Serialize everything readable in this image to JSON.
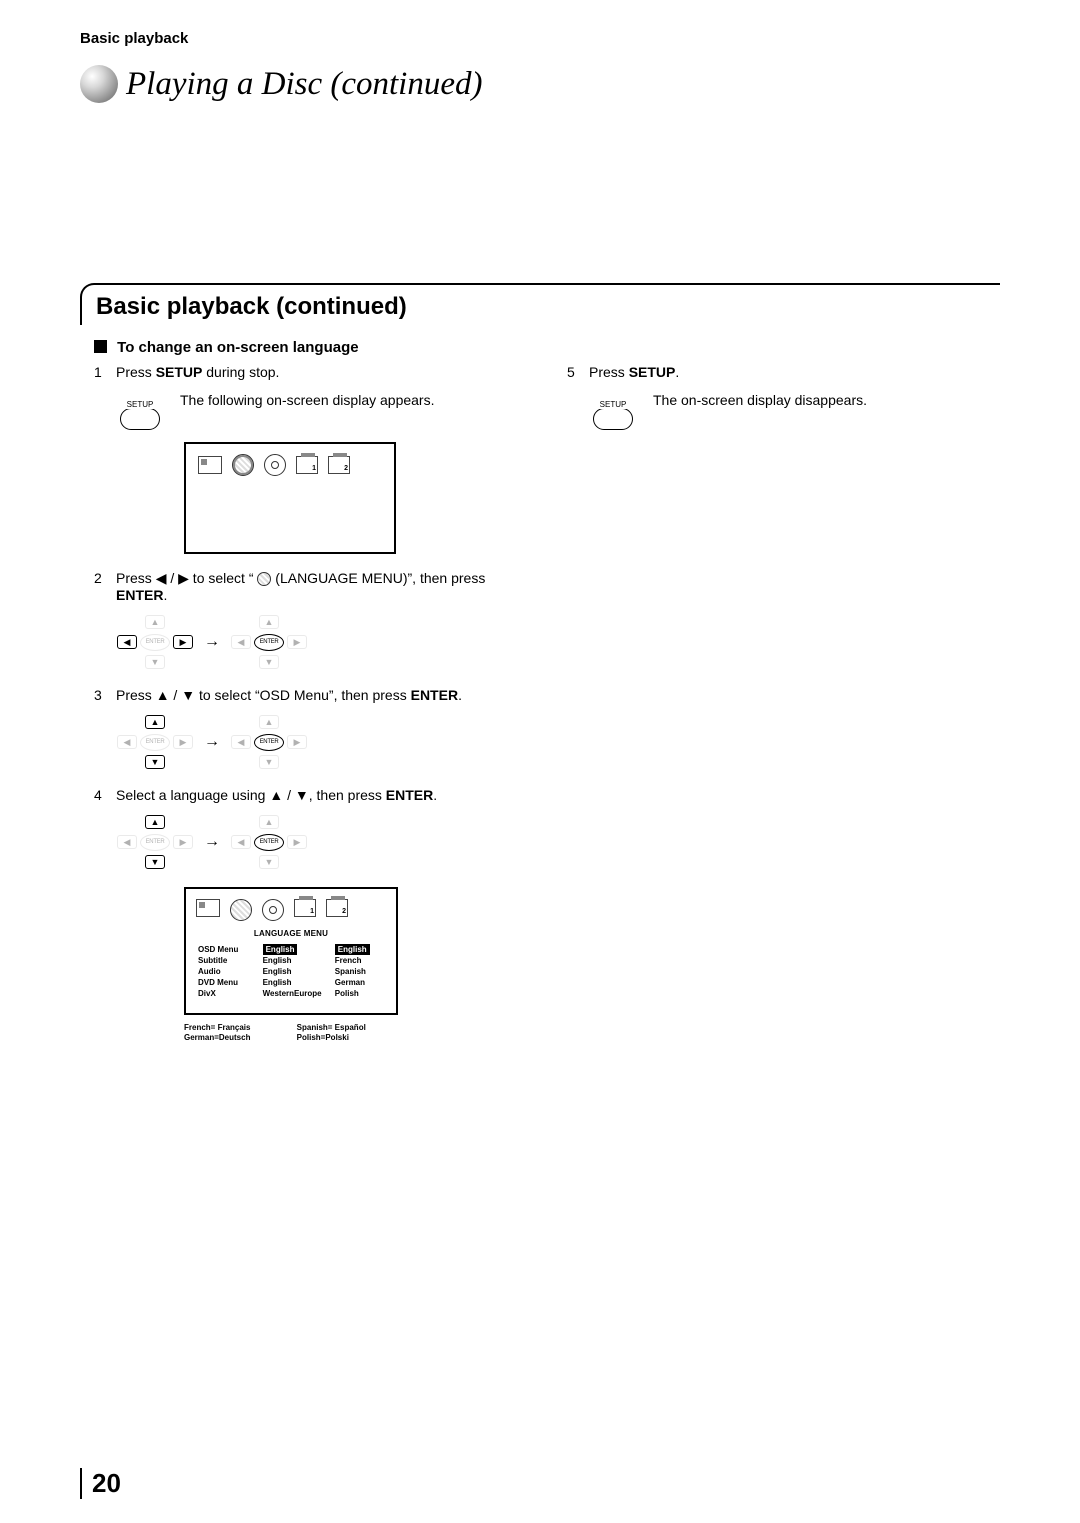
{
  "header": {
    "section": "Basic playback"
  },
  "title": "Playing a Disc (continued)",
  "sectionTitle": "Basic playback (continued)",
  "subHeading": "To change an on-screen language",
  "left": {
    "s1": {
      "num": "1",
      "a": "Press ",
      "b": "SETUP",
      "c": " during stop."
    },
    "s1_caption": "The following on-screen display appears.",
    "s2": {
      "num": "2",
      "pre": "Press ",
      "mid": " to select “ ",
      "post": " (LANGUAGE MENU)”, then press ",
      "enter": "ENTER",
      "end": "."
    },
    "s3": {
      "num": "3",
      "pre": "Press ",
      "mid": " to select “OSD Menu”, then press ",
      "enter": "ENTER",
      "end": "."
    },
    "s4": {
      "num": "4",
      "pre": "Select a language using ",
      "mid": ", then press ",
      "enter": "ENTER",
      "end": "."
    }
  },
  "right": {
    "s5": {
      "num": "5",
      "a": "Press ",
      "b": "SETUP",
      "c": "."
    },
    "s5_caption": "The on-screen display disappears."
  },
  "setupLabel": "SETUP",
  "enterLabel": "ENTER",
  "dpad": {
    "left": "◀",
    "right": "▶",
    "up": "▲",
    "down": "▼"
  },
  "langMenu": {
    "title": "LANGUAGE MENU",
    "rows": [
      {
        "label": "OSD Menu",
        "valLeft": "English",
        "valRight": "English",
        "highlight": true
      },
      {
        "label": "Subtitle",
        "valLeft": "English",
        "valRight": "French"
      },
      {
        "label": "Audio",
        "valLeft": "English",
        "valRight": "Spanish"
      },
      {
        "label": "DVD Menu",
        "valLeft": "English",
        "valRight": "German"
      },
      {
        "label": "DivX",
        "valLeft": "WesternEurope",
        "valRight": "Polish"
      }
    ]
  },
  "langNotes": {
    "a": "French= Français",
    "b": "Spanish= Español",
    "c": "German=Deutsch",
    "d": "Polish=Polski"
  },
  "osdSetLabels": {
    "one": "1",
    "two": "2"
  },
  "pageNumber": "20"
}
